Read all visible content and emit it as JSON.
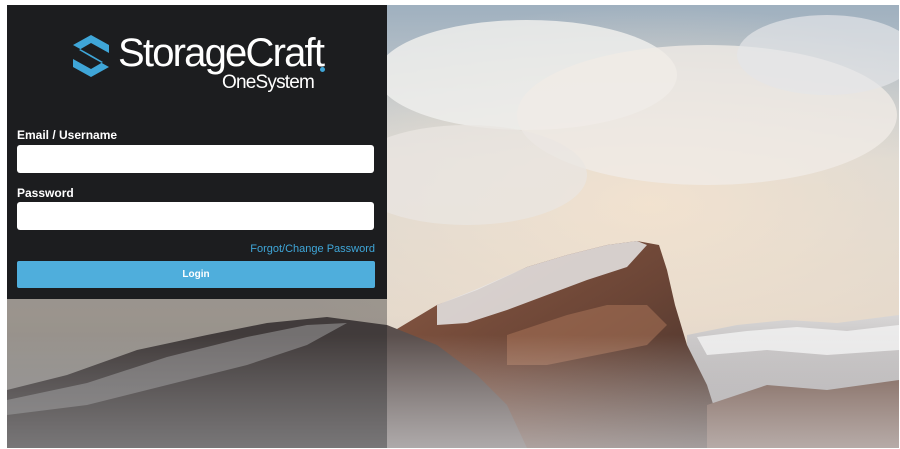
{
  "brand": {
    "name": "StorageCraft",
    "product": "OneSystem",
    "accent_color": "#3fa6d8"
  },
  "login_form": {
    "email_label": "Email / Username",
    "email_value": "",
    "password_label": "Password",
    "password_value": "",
    "forgot_link": "Forgot/Change Password",
    "login_button": "Login",
    "button_color": "#4faedc",
    "panel_color": "#1c1d1f"
  },
  "background": {
    "subject": "snow-covered mountain peak under clouds"
  }
}
